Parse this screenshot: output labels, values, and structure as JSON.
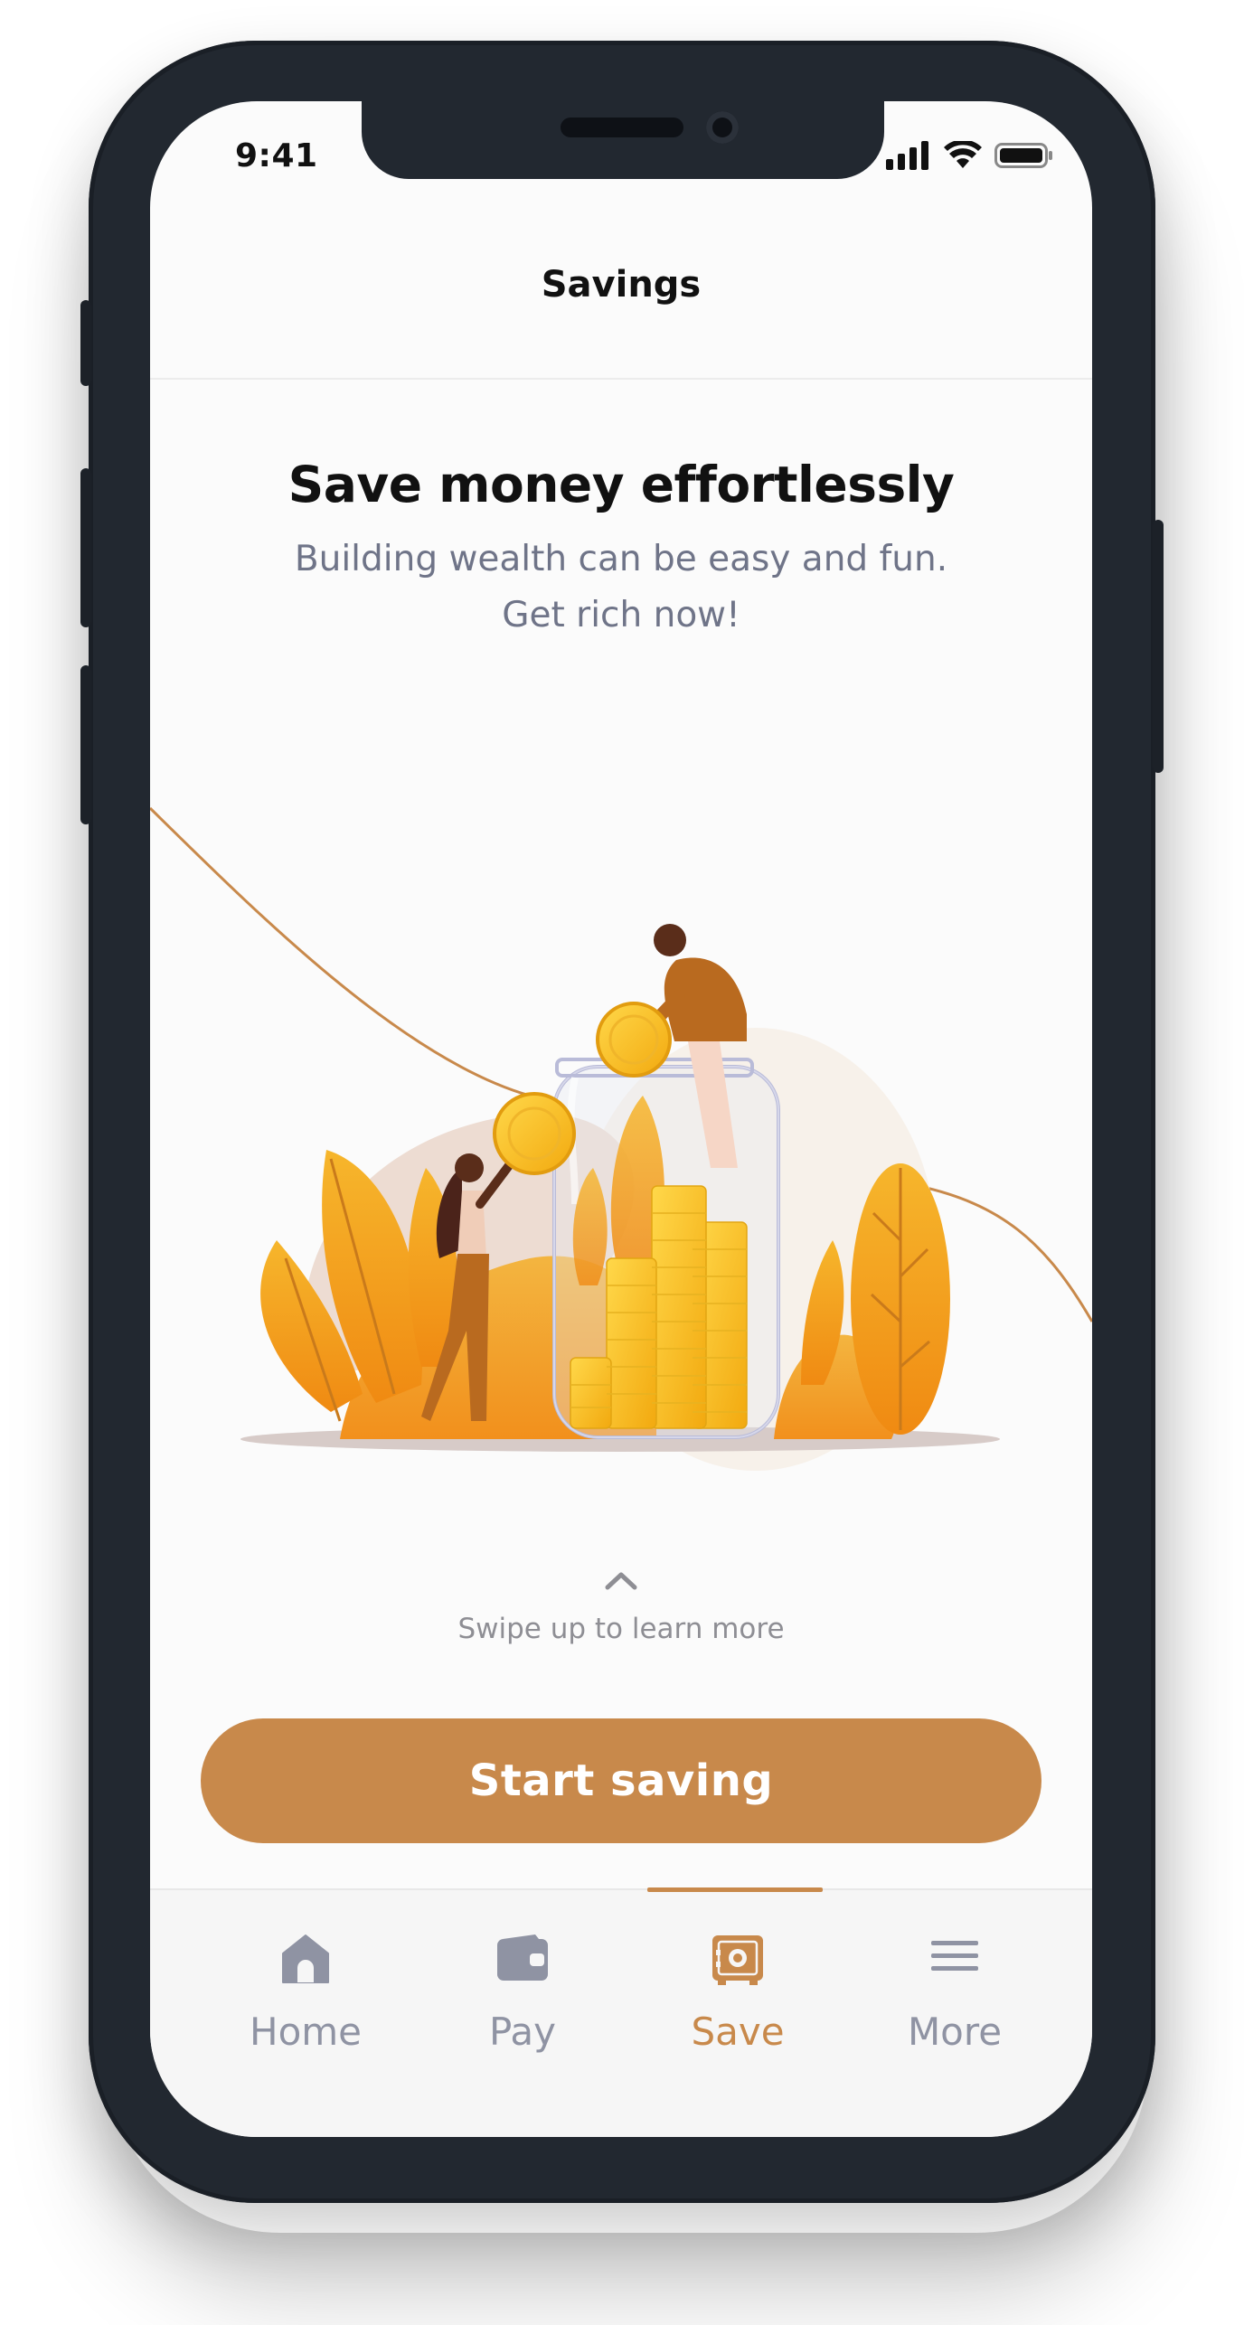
{
  "status_bar": {
    "time": "9:41"
  },
  "header": {
    "title": "Savings"
  },
  "hero": {
    "headline": "Save money effortlessly",
    "subtitle_line1": "Building wealth can be easy and fun.",
    "subtitle_line2": "Get rich now!"
  },
  "swipe_hint": "Swipe up to learn more",
  "cta_label": "Start saving",
  "tabs": [
    {
      "label": "Home",
      "icon": "home-icon",
      "active": false
    },
    {
      "label": "Pay",
      "icon": "wallet-icon",
      "active": false
    },
    {
      "label": "Save",
      "icon": "safe-icon",
      "active": true
    },
    {
      "label": "More",
      "icon": "menu-icon",
      "active": false
    }
  ],
  "colors": {
    "accent": "#c8894b",
    "inactive_tab": "#8f93a3",
    "subtitle": "#6f7488",
    "device_frame": "#222830"
  }
}
